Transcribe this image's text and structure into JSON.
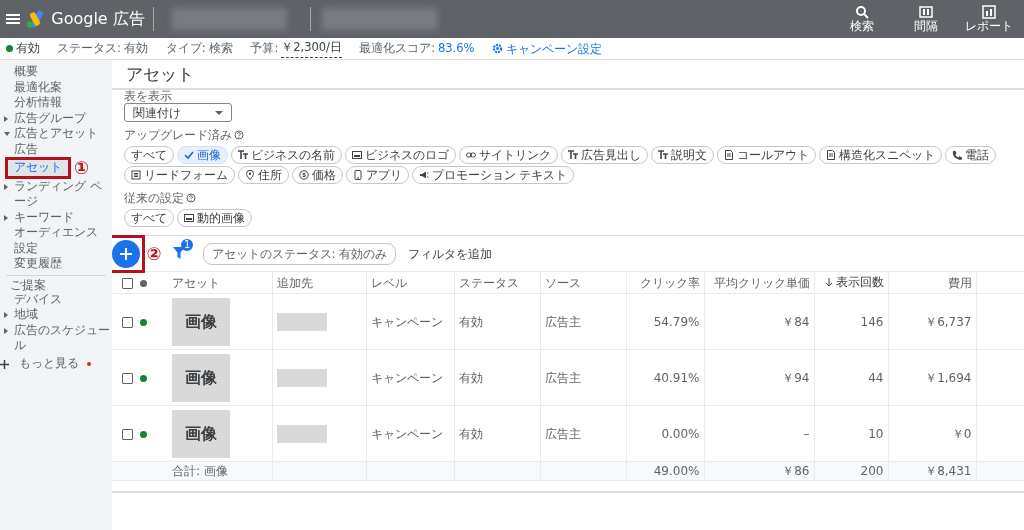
{
  "header": {
    "product": "Google 広告",
    "actions": [
      {
        "label": "検索",
        "kind": "search"
      },
      {
        "label": "間隔",
        "kind": "columns"
      },
      {
        "label": "レポート",
        "kind": "report"
      }
    ]
  },
  "status_bar": [
    {
      "kind": "dot",
      "text": "有効",
      "color": "#188038"
    },
    {
      "kind": "plain",
      "label": "ステータス:",
      "value": "有効"
    },
    {
      "kind": "plain",
      "label": "タイプ:",
      "value": "検索"
    },
    {
      "kind": "budget",
      "label": "予算:",
      "value": "￥2,300/日"
    },
    {
      "kind": "score",
      "label": "最適化スコア:",
      "value": "83.6%"
    },
    {
      "kind": "link",
      "text": "キャンペーン設定"
    }
  ],
  "sidebar": {
    "groups": [
      {
        "items": [
          {
            "label": "概要",
            "selected": false
          },
          {
            "label": "最適化案",
            "selected": false
          },
          {
            "label": "分析情報",
            "selected": false
          },
          {
            "label": "広告グループ",
            "selected": false,
            "expanded": false
          },
          {
            "label": "広告とアセット",
            "selected": false,
            "expanded": true,
            "children": [
              {
                "label": "広告",
                "selected": false
              },
              {
                "label": "アセット",
                "selected": true,
                "highlighted": true,
                "callout": "①"
              }
            ]
          },
          {
            "label": "ランディング ページ",
            "selected": false,
            "expanded": false
          },
          {
            "label": "キーワード",
            "selected": false,
            "expanded": false
          },
          {
            "label": "オーディエンス",
            "selected": false
          },
          {
            "label": "設定",
            "selected": false
          },
          {
            "label": "変更履歴",
            "selected": false
          }
        ]
      },
      {
        "heading": "ご提案",
        "items": [
          {
            "label": "デバイス",
            "selected": false
          },
          {
            "label": "地域",
            "selected": false,
            "expanded": false
          },
          {
            "label": "広告のスケジュール",
            "selected": false,
            "expanded": false
          }
        ]
      }
    ],
    "more": {
      "label": "もっと見る",
      "alert": true
    }
  },
  "page_title": "アセット",
  "view": {
    "label": "表を表示",
    "value": "関連付け"
  },
  "upgraded": {
    "label": "アップグレード済み",
    "chips": [
      {
        "label": "すべて",
        "kind": "all",
        "selected": false
      },
      {
        "label": "画像",
        "selected": true
      },
      {
        "label": "ビジネスの名前",
        "kind": "text",
        "selected": false
      },
      {
        "label": "ビジネスのロゴ",
        "kind": "image",
        "selected": false
      },
      {
        "label": "サイトリンク",
        "kind": "link",
        "selected": false
      },
      {
        "label": "広告見出し",
        "kind": "text",
        "selected": false
      },
      {
        "label": "説明文",
        "kind": "text",
        "selected": false
      },
      {
        "label": "コールアウト",
        "kind": "doc",
        "selected": false
      },
      {
        "label": "構造化スニペット",
        "kind": "doc",
        "selected": false
      },
      {
        "label": "電話",
        "kind": "phone",
        "selected": false
      },
      {
        "label": "リードフォーム",
        "kind": "form",
        "selected": false
      },
      {
        "label": "住所",
        "kind": "place",
        "selected": false
      },
      {
        "label": "価格",
        "kind": "price",
        "selected": false
      },
      {
        "label": "アプリ",
        "kind": "app",
        "selected": false
      },
      {
        "label": "プロモーション テキスト",
        "kind": "promo",
        "selected": false
      }
    ]
  },
  "legacy": {
    "label": "従来の設定",
    "chips": [
      {
        "label": "すべて",
        "kind": "all",
        "selected": false
      },
      {
        "label": "動的画像",
        "kind": "image",
        "selected": false
      }
    ]
  },
  "toolbar": {
    "add_button": {
      "highlighted": true,
      "callout": "②"
    },
    "filter_count": "1",
    "filter_chip": "アセットのステータス: 有効のみ",
    "add_filter": "フィルタを追加"
  },
  "table": {
    "select_all": {
      "checked": false
    },
    "columns": [
      {
        "label": "アセット",
        "kind": "image",
        "sorted": false
      },
      {
        "label": "追加先",
        "kind": "redacted",
        "sorted": false
      },
      {
        "label": "レベル",
        "kind": "text",
        "sorted": false
      },
      {
        "label": "ステータス",
        "kind": "text",
        "sorted": false
      },
      {
        "label": "ソース",
        "kind": "text",
        "sorted": false
      },
      {
        "label": "クリック率",
        "kind": "number",
        "sorted": false
      },
      {
        "label": "平均クリック単価",
        "kind": "number",
        "sorted": false
      },
      {
        "label": "表示回数",
        "kind": "number",
        "sorted": true
      },
      {
        "label": "費用",
        "kind": "number",
        "sorted": false
      }
    ],
    "rows": [
      {
        "checked": false,
        "color": "#188038",
        "cells": [
          "画像",
          "",
          "キャンペーン",
          "有効",
          "広告主",
          "54.79%",
          "￥84",
          "146",
          "￥6,737"
        ]
      },
      {
        "checked": false,
        "color": "#188038",
        "cells": [
          "画像",
          "",
          "キャンペーン",
          "有効",
          "広告主",
          "40.91%",
          "￥94",
          "44",
          "￥1,694"
        ]
      },
      {
        "checked": false,
        "color": "#188038",
        "cells": [
          "画像",
          "",
          "キャンペーン",
          "有効",
          "広告主",
          "0.00%",
          "–",
          "10",
          "￥0"
        ]
      }
    ],
    "total": {
      "cells": [
        "合計: 画像",
        "",
        "",
        "",
        "",
        "49.00%",
        "￥86",
        "200",
        "￥8,431"
      ]
    }
  }
}
